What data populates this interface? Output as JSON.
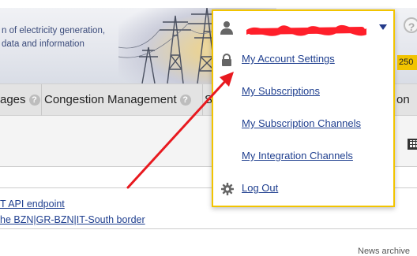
{
  "banner": {
    "title_cut": "ʿʾ",
    "text_line1": "n of electricity generation,",
    "text_line2": "data and information",
    "lang_badge": "250",
    "help_glyph": "?"
  },
  "nav": {
    "items": [
      {
        "label": "ages",
        "help": "?"
      },
      {
        "label": "Congestion Management",
        "help": "?"
      },
      {
        "label": "S"
      },
      {
        "label": "on"
      }
    ]
  },
  "news": {
    "links": [
      "T API endpoint",
      "he BZN|GR-BZN|IT-South border"
    ],
    "archive": "News archive"
  },
  "user_menu": {
    "items": [
      {
        "label": "My Account Settings",
        "icon": "lock-icon"
      },
      {
        "label": "My Subscriptions"
      },
      {
        "label": "My Subscription Channels"
      },
      {
        "label": "My Integration Channels"
      },
      {
        "label": "Log Out",
        "icon": "gear-icon"
      }
    ]
  },
  "colors": {
    "accent": "#f2c400",
    "link": "#1f3f8f",
    "annotation": "#e8191f"
  }
}
